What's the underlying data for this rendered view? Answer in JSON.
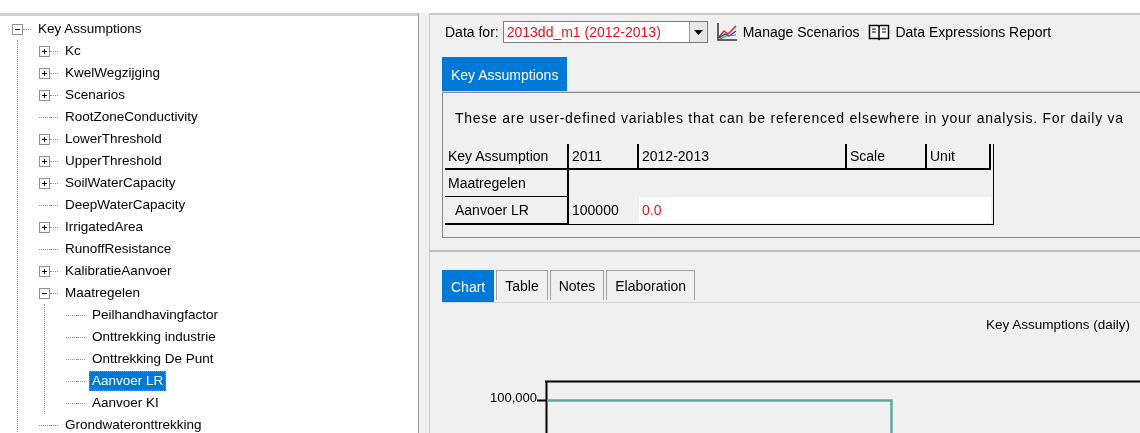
{
  "tree": [
    {
      "label": "Key Assumptions",
      "kind": "group",
      "expanded": true,
      "selected": false,
      "children": [
        {
          "label": "Kc",
          "kind": "group",
          "expanded": false,
          "selected": false
        },
        {
          "label": "KwelWegzijging",
          "kind": "group",
          "expanded": false,
          "selected": false
        },
        {
          "label": "Scenarios",
          "kind": "group",
          "expanded": false,
          "selected": false
        },
        {
          "label": "RootZoneConductivity",
          "kind": "leaf",
          "selected": false
        },
        {
          "label": "LowerThreshold",
          "kind": "group",
          "expanded": false,
          "selected": false
        },
        {
          "label": "UpperThreshold",
          "kind": "group",
          "expanded": false,
          "selected": false
        },
        {
          "label": "SoilWaterCapacity",
          "kind": "group",
          "expanded": false,
          "selected": false
        },
        {
          "label": "DeepWaterCapacity",
          "kind": "leaf",
          "selected": false
        },
        {
          "label": "IrrigatedArea",
          "kind": "group",
          "expanded": false,
          "selected": false
        },
        {
          "label": "RunoffResistance",
          "kind": "leaf",
          "selected": false
        },
        {
          "label": "KalibratieAanvoer",
          "kind": "group",
          "expanded": false,
          "selected": false
        },
        {
          "label": "Maatregelen",
          "kind": "group",
          "expanded": true,
          "selected": false,
          "children": [
            {
              "label": "Peilhandhavingfactor",
              "kind": "leaf",
              "selected": false
            },
            {
              "label": "Onttrekking industrie",
              "kind": "leaf",
              "selected": false
            },
            {
              "label": "Onttrekking De Punt",
              "kind": "leaf",
              "selected": false
            },
            {
              "label": "Aanvoer LR",
              "kind": "leaf",
              "selected": true
            },
            {
              "label": "Aanvoer KI",
              "kind": "leaf",
              "selected": false
            }
          ]
        },
        {
          "label": "Grondwateronttrekking",
          "kind": "leaf",
          "selected": false
        }
      ]
    }
  ],
  "toolbar": {
    "data_for_label": "Data for:",
    "scenario": "2013dd_m1 (2012-2013)",
    "buttons": [
      {
        "label": "Manage Scenarios",
        "kind": "chart"
      },
      {
        "label": "Data Expressions Report",
        "kind": "book"
      }
    ]
  },
  "top_tabs": [
    {
      "label": "Key Assumptions",
      "selected": true
    }
  ],
  "description": "These are user-defined variables that can be referenced elsewhere in your analysis.  For daily va",
  "table": {
    "columns": [
      "Key Assumption",
      "2011",
      "2012-2013",
      "Scale",
      "Unit"
    ],
    "rows": [
      {
        "kind": "group",
        "cells": [
          "Maatregelen"
        ]
      },
      {
        "kind": "item",
        "cells": [
          "Aanvoer LR",
          "100000",
          "0.0"
        ]
      }
    ]
  },
  "bottom_tabs": [
    {
      "label": "Chart",
      "selected": true
    },
    {
      "label": "Table",
      "selected": false
    },
    {
      "label": "Notes",
      "selected": false
    },
    {
      "label": "Elaboration",
      "selected": false
    }
  ],
  "chart": {
    "title": "Key Assumptions (daily)",
    "tick_label": "100,000"
  }
}
